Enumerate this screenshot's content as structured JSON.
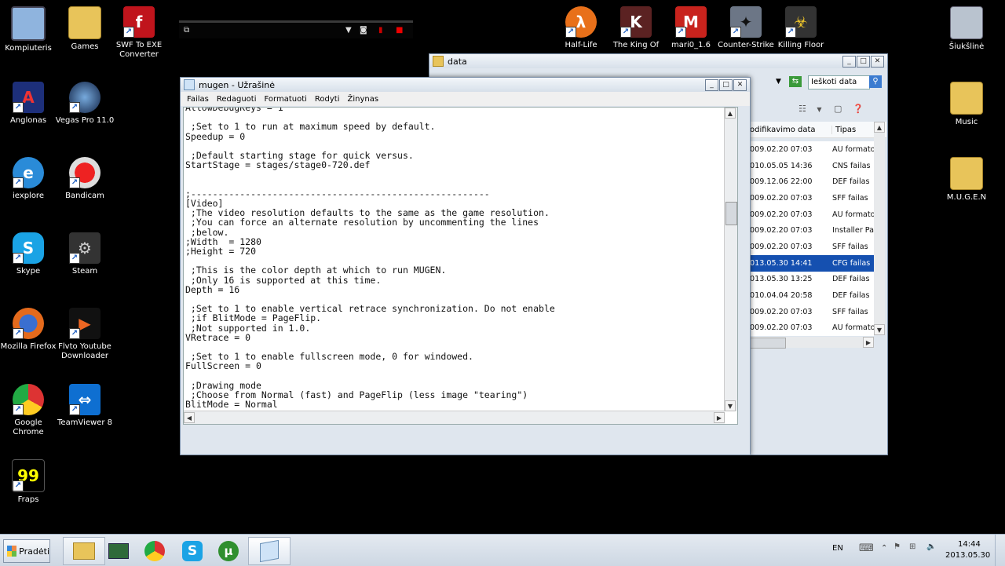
{
  "desktop": {
    "icons_left": [
      {
        "label": "Kompiuteris",
        "icon": "computer-icon"
      },
      {
        "label": "Games",
        "icon": "folder-icon"
      },
      {
        "label": "SWF To EXE Converter",
        "icon": "flash-icon"
      },
      {
        "label": "Anglonas",
        "icon": "anglonas-icon"
      },
      {
        "label": "Vegas Pro 11.0",
        "icon": "vegas-icon"
      },
      {
        "label": "iexplore",
        "icon": "ie-icon"
      },
      {
        "label": "Bandicam",
        "icon": "bandicam-icon"
      },
      {
        "label": "Skype",
        "icon": "skype-icon"
      },
      {
        "label": "Steam",
        "icon": "steam-icon"
      },
      {
        "label": "Mozilla Firefox",
        "icon": "firefox-icon"
      },
      {
        "label": "Flvto Youtube Downloader",
        "icon": "flvto-icon"
      },
      {
        "label": "Google Chrome",
        "icon": "chrome-icon"
      },
      {
        "label": "TeamViewer 8",
        "icon": "teamviewer-icon"
      },
      {
        "label": "Fraps",
        "icon": "fraps-icon"
      }
    ],
    "icons_top": [
      {
        "label": "Half-Life",
        "icon": "half-life-icon"
      },
      {
        "label": "The King Of",
        "icon": "kof-icon"
      },
      {
        "label": "mari0_1.6",
        "icon": "mario-icon"
      },
      {
        "label": "Counter-Strike",
        "icon": "counter-strike-icon"
      },
      {
        "label": "Killing Floor",
        "icon": "killing-floor-icon"
      }
    ],
    "icons_right": [
      {
        "label": "Šiukšlinė",
        "icon": "recycle-bin-icon"
      },
      {
        "label": "Music",
        "icon": "folder-icon"
      },
      {
        "label": "M.U.G.E.N",
        "icon": "folder-icon"
      }
    ]
  },
  "explorer": {
    "title": "data",
    "search_placeholder": "Ieškoti data",
    "col_date": "odifikavimo data",
    "col_type": "Tipas",
    "rows": [
      {
        "date": "009.02.20 07:03",
        "type": "AU formato"
      },
      {
        "date": "010.05.05 14:36",
        "type": "CNS failas"
      },
      {
        "date": "009.12.06 22:00",
        "type": "DEF failas"
      },
      {
        "date": "009.02.20 07:03",
        "type": "SFF failas"
      },
      {
        "date": "009.02.20 07:03",
        "type": "AU formato"
      },
      {
        "date": "009.02.20 07:03",
        "type": "Installer Pa"
      },
      {
        "date": "009.02.20 07:03",
        "type": "SFF failas"
      },
      {
        "date": "013.05.30 14:41",
        "type": "CFG failas"
      },
      {
        "date": "013.05.30 13:25",
        "type": "DEF failas"
      },
      {
        "date": "010.04.04 20:58",
        "type": "DEF failas"
      },
      {
        "date": "009.02.20 07:03",
        "type": "SFF failas"
      },
      {
        "date": "009.02.20 07:03",
        "type": "AU formato"
      }
    ]
  },
  "notepad": {
    "title": "mugen - Užrašinė",
    "menu": [
      "Failas",
      "Redaguoti",
      "Formatuoti",
      "Rodyti",
      "Žinynas"
    ],
    "text": "AllowDebugKeys = 1\n\n ;Set to 1 to run at maximum speed by default.\nSpeedup = 0\n\n ;Default starting stage for quick versus.\nStartStage = stages/stage0-720.def\n\n\n;-------------------------------------------------------\n[Video]\n ;The video resolution defaults to the same as the game resolution.\n ;You can force an alternate resolution by uncommenting the lines\n ;below.\n;Width  = 1280\n;Height = 720\n\n ;This is the color depth at which to run MUGEN.\n ;Only 16 is supported at this time.\nDepth = 16\n\n ;Set to 1 to enable vertical retrace synchronization. Do not enable\n ;if BlitMode = PageFlip.\n ;Not supported in 1.0.\nVRetrace = 0\n\n ;Set to 1 to enable fullscreen mode, 0 for windowed.\nFullScreen = 0\n\n ;Drawing mode\n ;Choose from Normal (fast) and PageFlip (less image \"tearing\")\nBlitMode = Normal\n\n ;Screen rendering mode."
  },
  "taskbar": {
    "start_label": "Pradėti",
    "lang": "EN",
    "time": "14:44",
    "date": "2013.05.30"
  }
}
